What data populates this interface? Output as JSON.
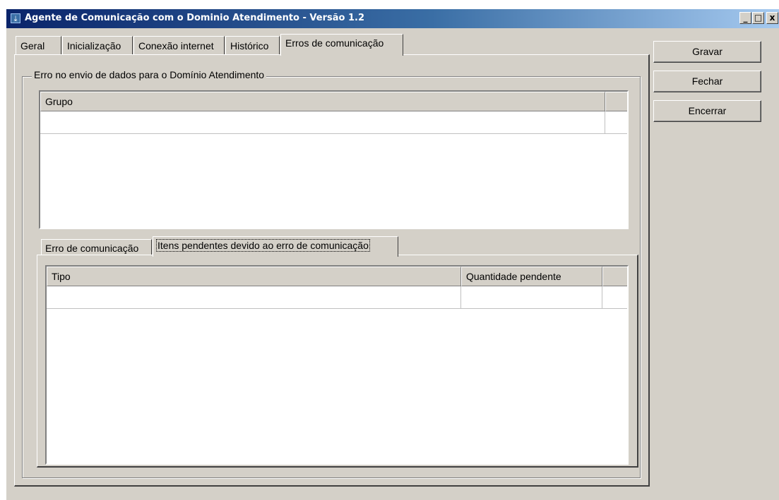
{
  "window": {
    "title": "Agente de Comunicação com o Dominio Atendimento - Versão 1.2",
    "icon": "download-icon",
    "controls": {
      "minimize": "_",
      "maximize": "□",
      "close": "x"
    }
  },
  "tabs": [
    {
      "label": "Geral"
    },
    {
      "label": "Inicialização"
    },
    {
      "label": "Conexão internet"
    },
    {
      "label": "Histórico"
    },
    {
      "label": "Erros de comunicação",
      "active": true
    }
  ],
  "group": {
    "legend": "Erro no envio de dados para o Domínio Atendimento"
  },
  "top_grid": {
    "columns": [
      "Grupo"
    ],
    "rows": []
  },
  "sub_tabs": [
    {
      "label": "Erro de comunicação"
    },
    {
      "label": "Itens pendentes devido ao erro de comunicação",
      "active": true
    }
  ],
  "bottom_grid": {
    "columns": [
      "Tipo",
      "Quantidade pendente"
    ],
    "rows": []
  },
  "buttons": {
    "save": "Gravar",
    "close": "Fechar",
    "terminate": "Encerrar"
  },
  "colors": {
    "face": "#d4d0c8",
    "title_start": "#0a246a",
    "title_end": "#a6caf0"
  }
}
